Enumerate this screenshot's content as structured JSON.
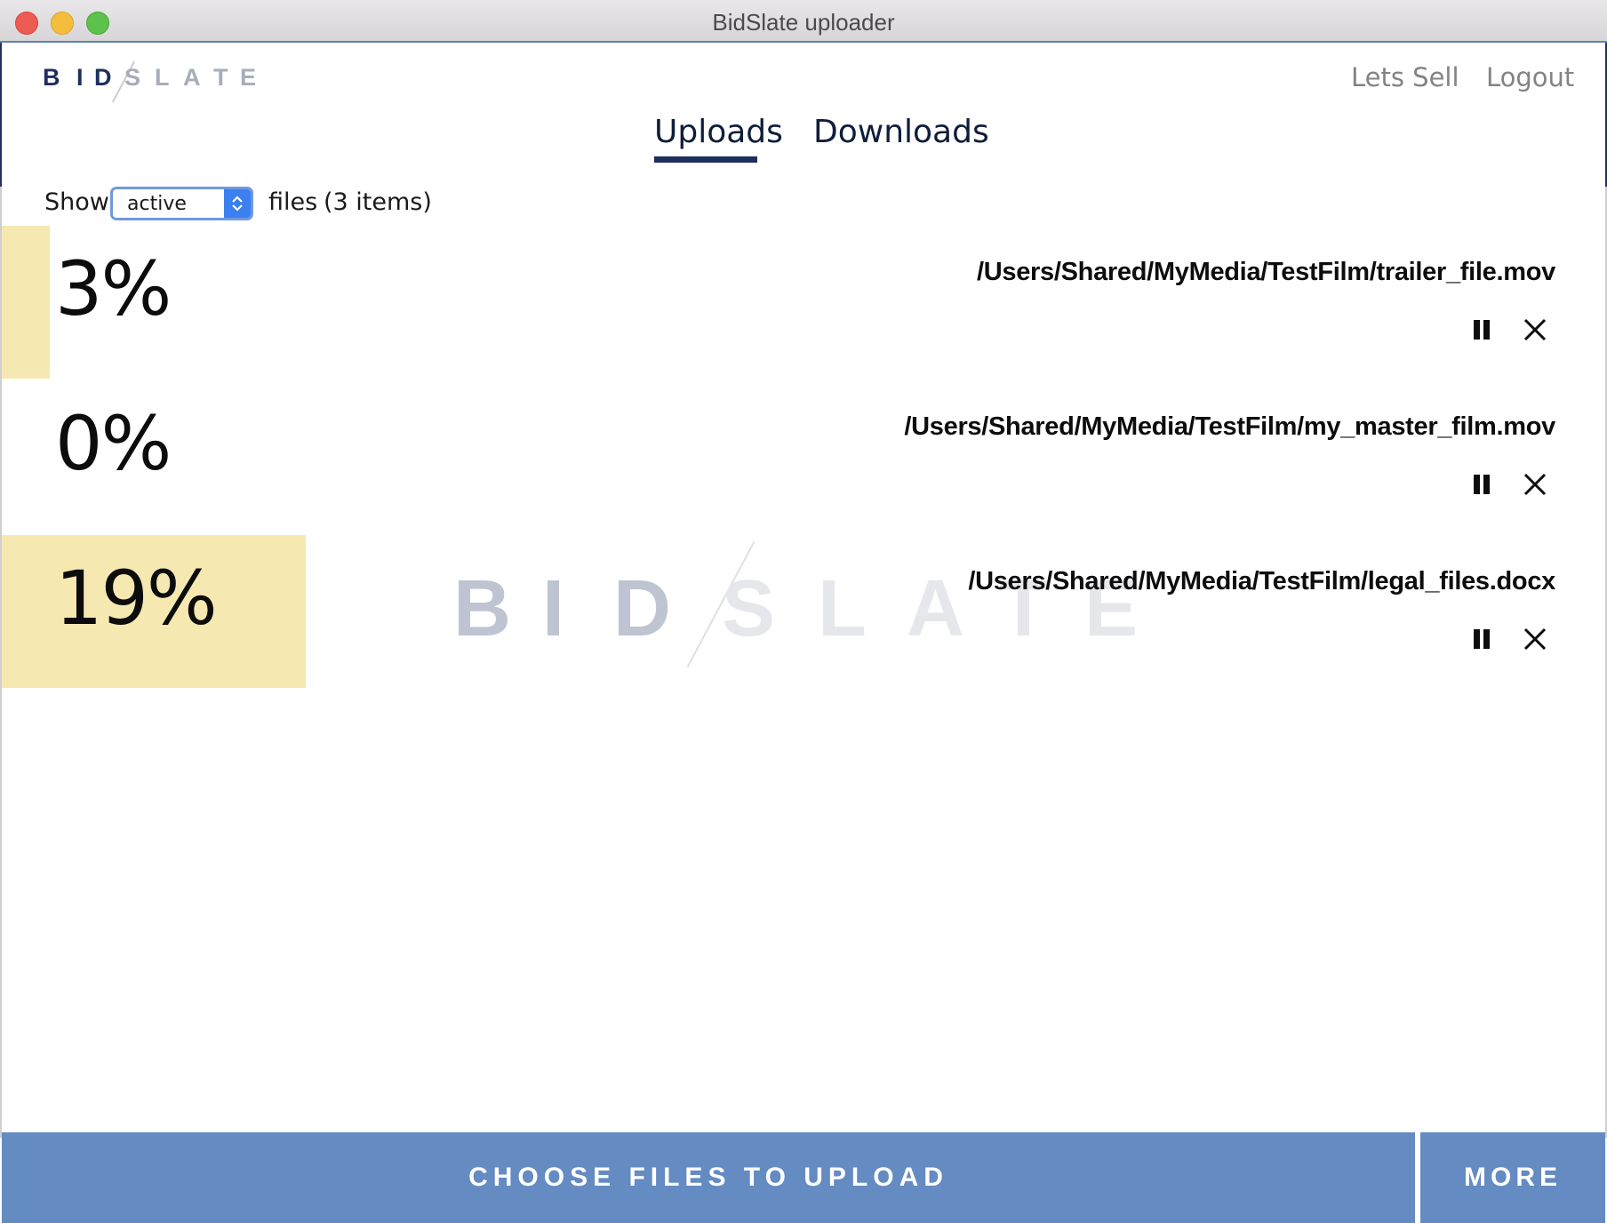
{
  "window": {
    "title": "BidSlate uploader"
  },
  "brand": {
    "logo_text": "BIDSLATE",
    "colors": {
      "navy": "#1e2f5f",
      "progress": "#f6e8b1",
      "footer": "#648bc2",
      "select_accent": "#3b7ff0"
    }
  },
  "topnav": {
    "lets_sell": "Lets Sell",
    "logout": "Logout"
  },
  "tabs": [
    {
      "label": "Uploads",
      "active": true
    },
    {
      "label": "Downloads",
      "active": false
    }
  ],
  "filter": {
    "show_label": "Show",
    "selected": "active",
    "files_label": "files",
    "count_label": "(3 items)"
  },
  "uploads": [
    {
      "percent_label": "3%",
      "progress": 0.03,
      "path": "/Users/Shared/MyMedia/TestFilm/trailer_file.mov",
      "pause_icon": "pause-icon",
      "cancel_icon": "close-icon"
    },
    {
      "percent_label": "0%",
      "progress": 0.0,
      "path": "/Users/Shared/MyMedia/TestFilm/my_master_film.mov",
      "pause_icon": "pause-icon",
      "cancel_icon": "close-icon"
    },
    {
      "percent_label": "19%",
      "progress": 0.19,
      "path": "/Users/Shared/MyMedia/TestFilm/legal_files.docx",
      "pause_icon": "pause-icon",
      "cancel_icon": "close-icon"
    }
  ],
  "footer": {
    "choose_files": "CHOOSE FILES TO UPLOAD",
    "more": "MORE"
  }
}
